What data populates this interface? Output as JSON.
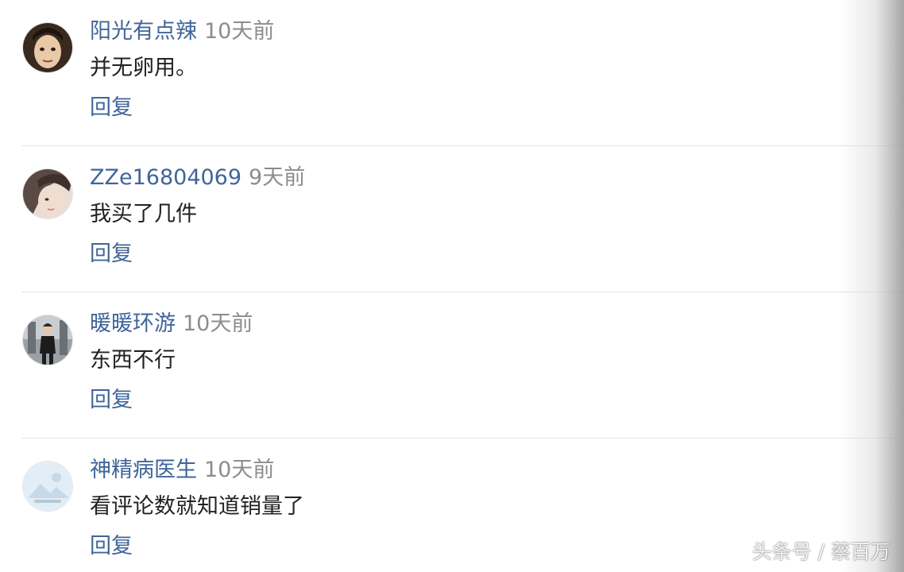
{
  "comments": [
    {
      "username": "阳光有点辣",
      "time": "10天前",
      "content": "并无卵用。",
      "reply_label": "回复",
      "avatar_icon": "cartoon-face-avatar"
    },
    {
      "username": "ZZe16804069",
      "time": "9天前",
      "content": "我买了几件",
      "reply_label": "回复",
      "avatar_icon": "portrait-photo-avatar"
    },
    {
      "username": "暖暖环游",
      "time": "10天前",
      "content": "东西不行",
      "reply_label": "回复",
      "avatar_icon": "standing-person-avatar"
    },
    {
      "username": "神精病医生",
      "time": "10天前",
      "content": "看评论数就知道销量了",
      "reply_label": "回复",
      "avatar_icon": "default-image-avatar"
    }
  ],
  "watermark": "头条号 / 蔡百万",
  "colors": {
    "username": "#406599",
    "time": "#8c8c8c",
    "content": "#222222",
    "divider": "#e3e3e3"
  }
}
